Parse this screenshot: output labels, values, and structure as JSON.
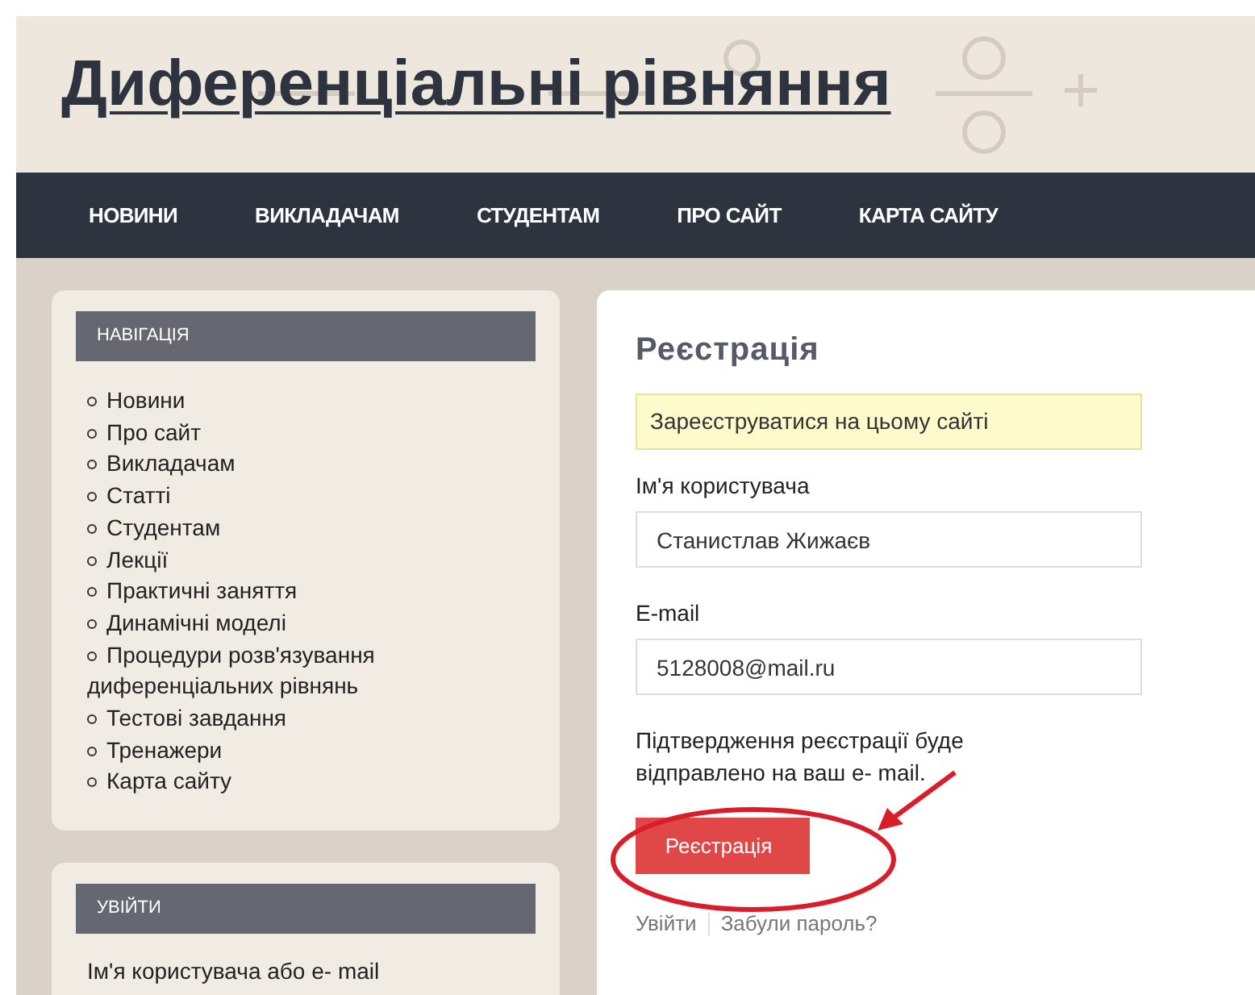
{
  "site_title": "Диференціальні рівняння",
  "nav": [
    {
      "label": "НОВИНИ"
    },
    {
      "label": "ВИКЛАДАЧАМ"
    },
    {
      "label": "СТУДЕНТАМ"
    },
    {
      "label": "ПРО САЙТ"
    },
    {
      "label": "КАРТА САЙТУ"
    }
  ],
  "sidebar": [
    {
      "title": "НАВІГАЦІЯ",
      "items": [
        "Новини",
        "Про сайт",
        "Викладачам",
        "Статті",
        "Студентам",
        "Лекції",
        "Практичні заняття",
        "Динамічні моделі",
        "Процедури розв'язування диференціальних рівнянь",
        "Тестові завдання",
        "Тренажери",
        "Карта сайту"
      ]
    },
    {
      "title": "УВІЙТИ",
      "text": "Ім'я користувача або e- mail"
    }
  ],
  "form": {
    "title": "Реєстрація",
    "notice": "Зареєструватися на цьому сайті",
    "fields": [
      {
        "label": "Ім'я користувача",
        "value": "Станистлав Жижаєв"
      },
      {
        "label": "E-mail",
        "value": "5128008@mail.ru"
      }
    ],
    "info": "Підтвердження реєстрації буде відправлено на ваш e- mail.",
    "button": "Реєстрація",
    "links": [
      "Увійти",
      "Забули пароль?"
    ]
  }
}
